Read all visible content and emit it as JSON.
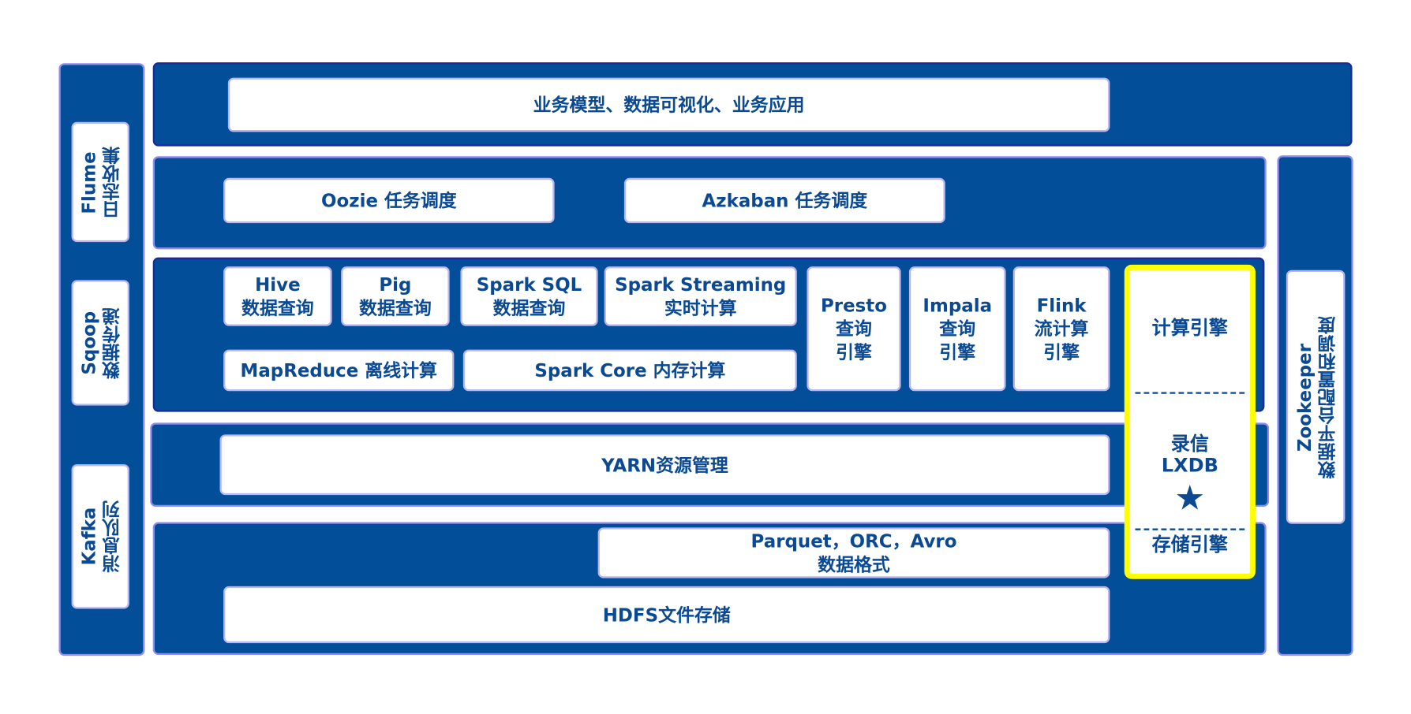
{
  "left_bar": {
    "items": [
      {
        "en": "Flume",
        "zh": "日志收集"
      },
      {
        "en": "Sqoop",
        "zh": "数据传递"
      },
      {
        "en": "Kafka",
        "zh": "消息队列"
      }
    ]
  },
  "right_bar": {
    "en": "Zookeeper",
    "zh": "数据平台配置和调度"
  },
  "app_layer": "业务模型、数据可视化、业务应用",
  "scheduling": [
    "Oozie 任务调度",
    "Azkaban 任务调度"
  ],
  "compute": {
    "hive": [
      "Hive",
      "数据查询"
    ],
    "pig": [
      "Pig",
      "数据查询"
    ],
    "spark_sql": [
      "Spark SQL",
      "数据查询"
    ],
    "spark_streaming": [
      "Spark Streaming",
      "实时计算"
    ],
    "mapreduce": "MapReduce 离线计算",
    "spark_core": "Spark Core 内存计算",
    "presto": [
      "Presto",
      "查询",
      "引擎"
    ],
    "impala": [
      "Impala",
      "查询",
      "引擎"
    ],
    "flink": [
      "Flink",
      "流计算",
      "引擎"
    ]
  },
  "yarn": "YARN资源管理",
  "storage": {
    "formats": [
      "Parquet，ORC，Avro",
      "数据格式"
    ],
    "hdfs": "HDFS文件存储"
  },
  "lxdb": {
    "compute_label": "计算引擎",
    "name_zh": "录信",
    "name_en": "LXDB",
    "star": "★",
    "storage_label": "存储引擎",
    "highlight_color": "#ffff00"
  },
  "colors": {
    "band": "#024e98",
    "text": "#0b4a93"
  }
}
